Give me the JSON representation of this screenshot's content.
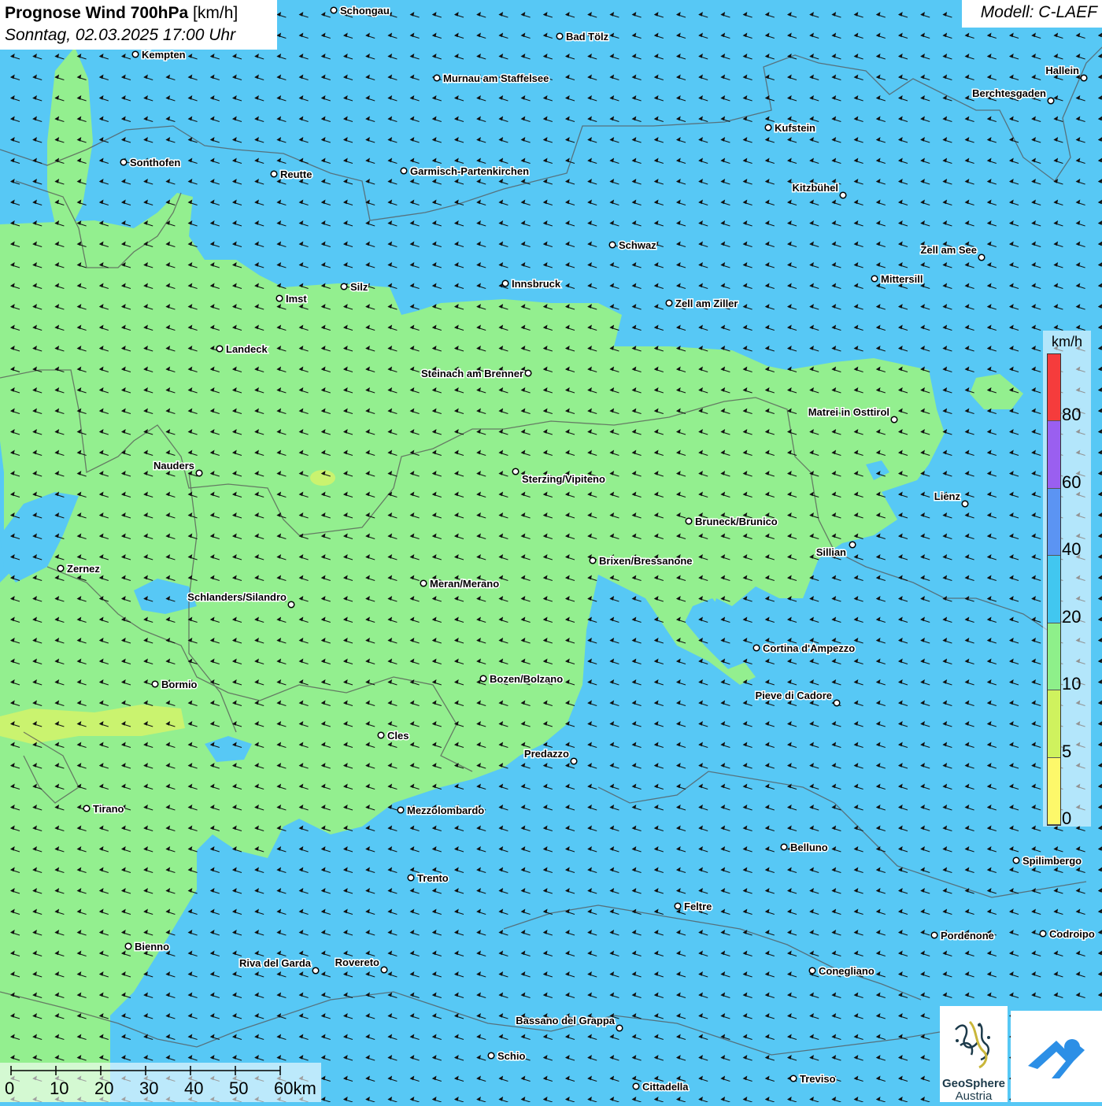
{
  "header": {
    "title_bold": "Prognose Wind 700hPa",
    "title_unit": "[km/h]",
    "subtitle": "Sonntag, 02.03.2025 17:00 Uhr",
    "model": "Modell: C-LAEF"
  },
  "legend": {
    "unit": "km/h",
    "classes": [
      {
        "from": 0,
        "to": 5,
        "color": "#fdf86a"
      },
      {
        "from": 5,
        "to": 10,
        "color": "#cff25e"
      },
      {
        "from": 10,
        "to": 20,
        "color": "#8ef08a"
      },
      {
        "from": 20,
        "to": 40,
        "color": "#41c7f0"
      },
      {
        "from": 40,
        "to": 60,
        "color": "#5b94f3"
      },
      {
        "from": 60,
        "to": 80,
        "color": "#9a5ff0"
      },
      {
        "from": 80,
        "to": 100,
        "color": "#f53c3c"
      }
    ],
    "tick_labels": [
      "0",
      "5",
      "10",
      "20",
      "40",
      "60",
      "80"
    ]
  },
  "scale_bar": {
    "labels": [
      "0",
      "10",
      "20",
      "30",
      "40",
      "50",
      "60km"
    ]
  },
  "map": {
    "wind_direction": "from east-northeast",
    "background_color": "#57c8f5",
    "calm_area_color": "#93ef8f",
    "cities": [
      "Schongau",
      "Bad Tölz",
      "Kempten",
      "Murnau am Staffelsee",
      "Hallein",
      "Berchtesgaden",
      "Kufstein",
      "Sonthofen",
      "Reutte",
      "Garmisch-Partenkirchen",
      "Kitzbühel",
      "Schwaz",
      "Zell am See",
      "Mittersill",
      "Innsbruck",
      "Silz",
      "Imst",
      "Zell am Ziller",
      "Landeck",
      "Steinach am Brenner",
      "Matrei in Osttirol",
      "Nauders",
      "Sterzing/Vipiteno",
      "Lienz",
      "Bruneck/Brunico",
      "Sillian",
      "Brixen/Bressanone",
      "Zernez",
      "Meran/Merano",
      "Schlanders/Silandro",
      "Cortina d'Ampezzo",
      "Bozen/Bolzano",
      "Bormio",
      "Pieve di Cadore",
      "Cles",
      "Predazzo",
      "Tirano",
      "Mezzolombardo",
      "Belluno",
      "Spilimbergo",
      "Trento",
      "Feltre",
      "Pordenone",
      "Codroipo",
      "Bienno",
      "Riva del Garda",
      "Rovereto",
      "Conegliano",
      "Bassano del Grappa",
      "Schio",
      "Treviso",
      "Cittadella"
    ]
  },
  "logos": {
    "geosphere_line1": "GeoSphere",
    "geosphere_line2": "Austria"
  }
}
